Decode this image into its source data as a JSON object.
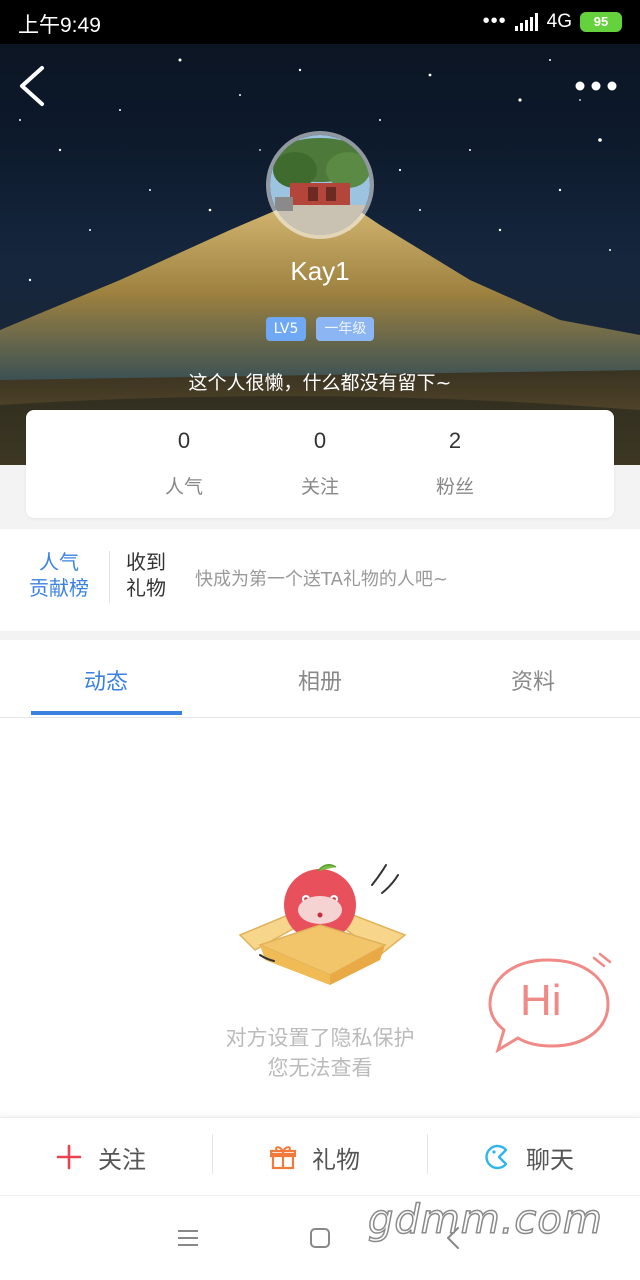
{
  "status_bar": {
    "time": "上午9:49",
    "signal_dots": "•••",
    "network": "4G",
    "battery": "95"
  },
  "profile": {
    "username": "Kay1",
    "level_badge": "LV5",
    "grade_badge": "一年级",
    "signature": "这个人很懒，什么都没有留下~"
  },
  "stats": [
    {
      "value": "0",
      "label": "人气"
    },
    {
      "value": "0",
      "label": "关注"
    },
    {
      "value": "2",
      "label": "粉丝"
    }
  ],
  "gifts": {
    "rank_line1": "人气",
    "rank_line2": "贡献榜",
    "received_line1": "收到",
    "received_line2": "礼物",
    "hint": "快成为第一个送TA礼物的人吧~"
  },
  "tabs": [
    {
      "label": "动态",
      "active": true
    },
    {
      "label": "相册",
      "active": false
    },
    {
      "label": "资料",
      "active": false
    }
  ],
  "empty_state": {
    "line1": "对方设置了隐私保护",
    "line2": "您无法查看",
    "hi_text": "Hi"
  },
  "actions": {
    "follow": "关注",
    "gift": "礼物",
    "chat": "聊天"
  },
  "watermark": "gdmm.com",
  "colors": {
    "accent_blue": "#3b82e0",
    "follow_red": "#e9434f",
    "gift_orange": "#f27a3a",
    "chat_blue": "#2fb5ee",
    "hi_pink": "#f08a86"
  },
  "icons": [
    "back-arrow-icon",
    "more-dots-icon",
    "plus-icon",
    "gift-icon",
    "chat-face-icon",
    "menu-icon",
    "home-square-icon",
    "nav-back-icon"
  ]
}
